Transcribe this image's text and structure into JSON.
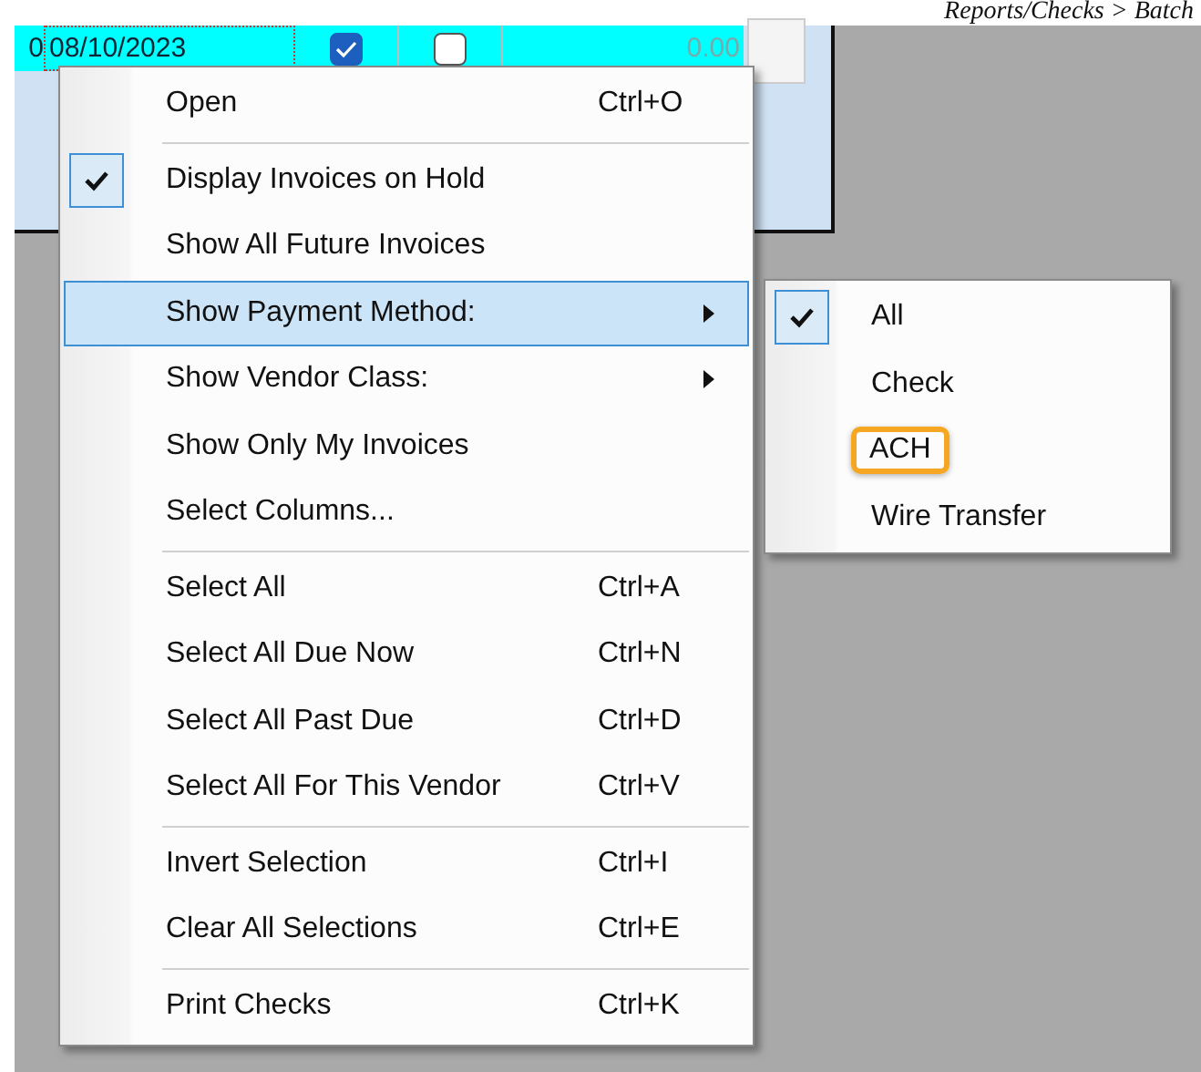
{
  "header": {
    "breadcrumb": "Reports/Checks > Batch"
  },
  "grid_row": {
    "selected": true,
    "column_1": "0",
    "date": "08/10/2023",
    "column_3_checked": true,
    "column_4_checked": false,
    "amount": "0.00"
  },
  "context_menu": {
    "groups": [
      [
        {
          "label": "Open",
          "shortcut": "Ctrl+O",
          "checked": false,
          "submenu": false,
          "selected": false
        }
      ],
      [
        {
          "label": "Display Invoices on Hold",
          "checked": true,
          "submenu": false,
          "selected": false
        },
        {
          "label": "Show All Future Invoices",
          "checked": false,
          "submenu": false,
          "selected": false
        },
        {
          "label": "Show Payment Method:",
          "checked": false,
          "submenu": true,
          "selected": true
        },
        {
          "label": "Show Vendor Class:",
          "checked": false,
          "submenu": true,
          "selected": false
        },
        {
          "label": "Show Only My Invoices",
          "checked": false,
          "submenu": false,
          "selected": false
        },
        {
          "label": "Select Columns...",
          "checked": false,
          "submenu": false,
          "selected": false
        }
      ],
      [
        {
          "label": "Select All",
          "shortcut": "Ctrl+A",
          "checked": false,
          "submenu": false,
          "selected": false
        },
        {
          "label": "Select All Due Now",
          "shortcut": "Ctrl+N",
          "checked": false,
          "submenu": false,
          "selected": false
        },
        {
          "label": "Select All Past Due",
          "shortcut": "Ctrl+D",
          "checked": false,
          "submenu": false,
          "selected": false
        },
        {
          "label": "Select All For This Vendor",
          "shortcut": "Ctrl+V",
          "checked": false,
          "submenu": false,
          "selected": false
        }
      ],
      [
        {
          "label": "Invert Selection",
          "shortcut": "Ctrl+I",
          "checked": false,
          "submenu": false,
          "selected": false
        },
        {
          "label": "Clear All Selections",
          "shortcut": "Ctrl+E",
          "checked": false,
          "submenu": false,
          "selected": false
        }
      ],
      [
        {
          "label": "Print Checks",
          "shortcut": "Ctrl+K",
          "checked": false,
          "submenu": false,
          "selected": false
        }
      ]
    ]
  },
  "submenu": {
    "items": [
      {
        "label": "All",
        "checked": true,
        "highlighted": false
      },
      {
        "label": "Check",
        "checked": false,
        "highlighted": false
      },
      {
        "label": "ACH",
        "checked": false,
        "highlighted": true
      },
      {
        "label": "Wire Transfer",
        "checked": false,
        "highlighted": false
      }
    ]
  }
}
